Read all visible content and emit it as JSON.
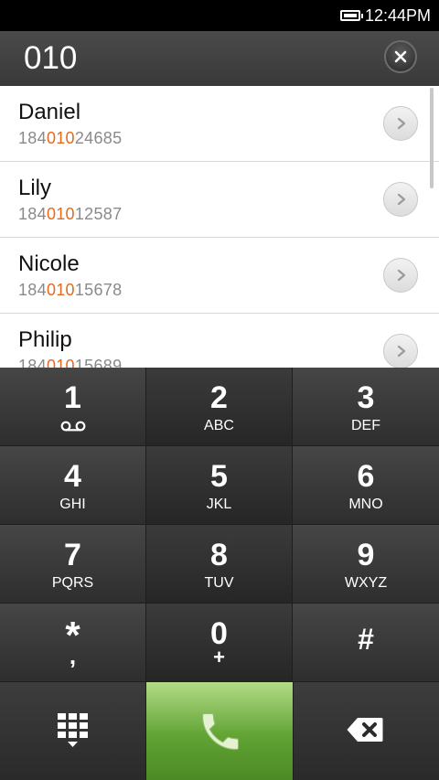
{
  "status_bar": {
    "time": "12:44PM"
  },
  "dialer": {
    "dialed_number": "010"
  },
  "contacts": [
    {
      "name": "Daniel",
      "number_prefix": "184",
      "number_match": "010",
      "number_suffix": "24685"
    },
    {
      "name": "Lily",
      "number_prefix": "184",
      "number_match": "010",
      "number_suffix": "12587"
    },
    {
      "name": "Nicole",
      "number_prefix": "184",
      "number_match": "010",
      "number_suffix": "15678"
    },
    {
      "name": "Philip",
      "number_prefix": "184",
      "number_match": "010",
      "number_suffix": "15689"
    }
  ],
  "keypad": {
    "keys": [
      {
        "digit": "1",
        "letters": ""
      },
      {
        "digit": "2",
        "letters": "ABC"
      },
      {
        "digit": "3",
        "letters": "DEF"
      },
      {
        "digit": "4",
        "letters": "GHI"
      },
      {
        "digit": "5",
        "letters": "JKL"
      },
      {
        "digit": "6",
        "letters": "MNO"
      },
      {
        "digit": "7",
        "letters": "PQRS"
      },
      {
        "digit": "8",
        "letters": "TUV"
      },
      {
        "digit": "9",
        "letters": "WXYZ"
      },
      {
        "digit": "*",
        "letters": ","
      },
      {
        "digit": "0",
        "letters": "+"
      },
      {
        "digit": "#",
        "letters": ""
      }
    ]
  },
  "icons": {
    "battery": "battery-icon",
    "clear": "close-icon",
    "details": "chevron-right-icon",
    "voicemail": "voicemail-icon",
    "keypad_toggle": "keypad-grid-icon",
    "call": "phone-icon",
    "backspace": "backspace-icon"
  },
  "colors": {
    "match_highlight": "#e86a1b",
    "call_button": "#61a334"
  }
}
